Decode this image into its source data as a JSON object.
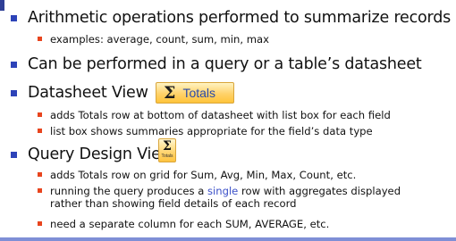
{
  "slide": {
    "b1": "Arithmetic operations performed to summarize records",
    "b1_sub": "examples: average, count, sum, min, max",
    "b2": "Can be performed in a query or a table’s datasheet",
    "b3": "Datasheet View",
    "b3_sub1": "adds Totals row at bottom of datasheet with list box for each field",
    "b3_sub2": "list box shows summaries appropriate for the field’s data type",
    "b4": "Query Design View",
    "b4_sub1": "adds Totals row on  grid for Sum, Avg, Min, Max, Count, etc.",
    "b4_sub2_pre": "running the query produces a ",
    "b4_sub2_hl": "single",
    "b4_sub2_post": " row with aggregates displayed rather than showing field details of each record",
    "b4_sub3": "need a separate column for each SUM, AVERAGE, etc."
  },
  "totals_button": {
    "symbol": "Σ",
    "label": "Totals"
  },
  "totals_icon": {
    "symbol": "Σ",
    "label": "Totals"
  },
  "colors": {
    "level1_bullet": "#2d43b8",
    "level2_bullet": "#e8451e",
    "highlight": "#3b50c8",
    "footer_line": "#7f8fd6"
  }
}
